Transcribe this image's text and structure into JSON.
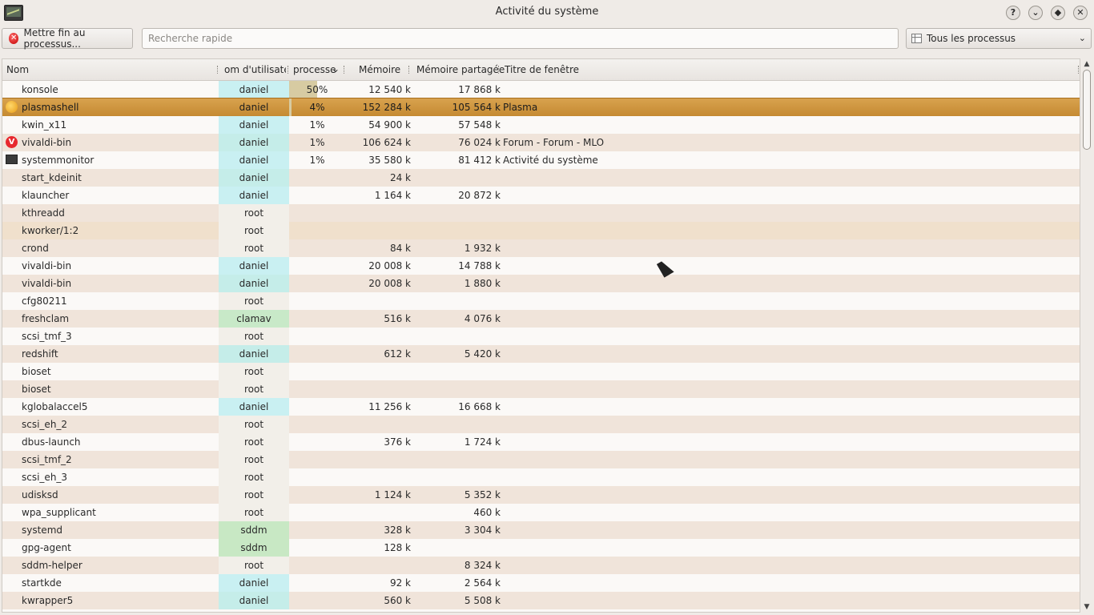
{
  "window": {
    "title": "Activité du système"
  },
  "toolbar": {
    "kill_label": "Mettre fin au processus...",
    "search_placeholder": "Recherche rapide",
    "filter_value": "Tous les processus"
  },
  "columns": {
    "name": "Nom",
    "user": "om d'utilisateı",
    "cpu": "processe",
    "memory": "Mémoire",
    "shared": "Mémoire partagée",
    "window": "Titre de fenêtre"
  },
  "rows": [
    {
      "name": "konsole",
      "user": "daniel",
      "cpu": "50%",
      "cpu_level": 50,
      "mem": "12 540 k",
      "shared": "17 868 k",
      "win": "",
      "icon": ""
    },
    {
      "name": "plasmashell",
      "user": "daniel",
      "cpu": "4%",
      "cpu_level": 4,
      "mem": "152 284 k",
      "shared": "105 564 k",
      "win": "Plasma",
      "icon": "plasma-icon",
      "selected": true
    },
    {
      "name": "kwin_x11",
      "user": "daniel",
      "cpu": "1%",
      "cpu_level": 1,
      "mem": "54 900 k",
      "shared": "57 548 k",
      "win": "",
      "icon": ""
    },
    {
      "name": "vivaldi-bin",
      "user": "daniel",
      "cpu": "1%",
      "cpu_level": 1,
      "mem": "106 624 k",
      "shared": "76 024 k",
      "win": "Forum - Forum - MLO",
      "icon": "vivaldi-icon"
    },
    {
      "name": "systemmonitor",
      "user": "daniel",
      "cpu": "1%",
      "cpu_level": 1,
      "mem": "35 580 k",
      "shared": "81 412 k",
      "win": "Activité du système",
      "icon": "system-monitor-icon"
    },
    {
      "name": "start_kdeinit",
      "user": "daniel",
      "cpu": "",
      "mem": "24 k",
      "shared": "",
      "win": "",
      "icon": ""
    },
    {
      "name": "klauncher",
      "user": "daniel",
      "cpu": "",
      "mem": "1 164 k",
      "shared": "20 872 k",
      "win": "",
      "icon": ""
    },
    {
      "name": "kthreadd",
      "user": "root",
      "cpu": "",
      "mem": "",
      "shared": "",
      "win": "",
      "icon": ""
    },
    {
      "name": "kworker/1:2",
      "user": "root",
      "cpu": "",
      "mem": "",
      "shared": "",
      "win": "",
      "icon": ""
    },
    {
      "name": "crond",
      "user": "root",
      "cpu": "",
      "mem": "84 k",
      "shared": "1 932 k",
      "win": "",
      "icon": ""
    },
    {
      "name": "vivaldi-bin",
      "user": "daniel",
      "cpu": "",
      "mem": "20 008 k",
      "shared": "14 788 k",
      "win": "",
      "icon": ""
    },
    {
      "name": "vivaldi-bin",
      "user": "daniel",
      "cpu": "",
      "mem": "20 008 k",
      "shared": "1 880 k",
      "win": "",
      "icon": ""
    },
    {
      "name": "cfg80211",
      "user": "root",
      "cpu": "",
      "mem": "",
      "shared": "",
      "win": "",
      "icon": ""
    },
    {
      "name": "freshclam",
      "user": "clamav",
      "cpu": "",
      "mem": "516 k",
      "shared": "4 076 k",
      "win": "",
      "icon": ""
    },
    {
      "name": "scsi_tmf_3",
      "user": "root",
      "cpu": "",
      "mem": "",
      "shared": "",
      "win": "",
      "icon": ""
    },
    {
      "name": "redshift",
      "user": "daniel",
      "cpu": "",
      "mem": "612 k",
      "shared": "5 420 k",
      "win": "",
      "icon": ""
    },
    {
      "name": "bioset",
      "user": "root",
      "cpu": "",
      "mem": "",
      "shared": "",
      "win": "",
      "icon": ""
    },
    {
      "name": "bioset",
      "user": "root",
      "cpu": "",
      "mem": "",
      "shared": "",
      "win": "",
      "icon": ""
    },
    {
      "name": "kglobalaccel5",
      "user": "daniel",
      "cpu": "",
      "mem": "11 256 k",
      "shared": "16 668 k",
      "win": "",
      "icon": ""
    },
    {
      "name": "scsi_eh_2",
      "user": "root",
      "cpu": "",
      "mem": "",
      "shared": "",
      "win": "",
      "icon": ""
    },
    {
      "name": "dbus-launch",
      "user": "root",
      "cpu": "",
      "mem": "376 k",
      "shared": "1 724 k",
      "win": "",
      "icon": ""
    },
    {
      "name": "scsi_tmf_2",
      "user": "root",
      "cpu": "",
      "mem": "",
      "shared": "",
      "win": "",
      "icon": ""
    },
    {
      "name": "scsi_eh_3",
      "user": "root",
      "cpu": "",
      "mem": "",
      "shared": "",
      "win": "",
      "icon": ""
    },
    {
      "name": "udisksd",
      "user": "root",
      "cpu": "",
      "mem": "1 124 k",
      "shared": "5 352 k",
      "win": "",
      "icon": ""
    },
    {
      "name": "wpa_supplicant",
      "user": "root",
      "cpu": "",
      "mem": "",
      "shared": "460 k",
      "win": "",
      "icon": ""
    },
    {
      "name": "systemd",
      "user": "sddm",
      "cpu": "",
      "mem": "328 k",
      "shared": "3 304 k",
      "win": "",
      "icon": ""
    },
    {
      "name": "gpg-agent",
      "user": "sddm",
      "cpu": "",
      "mem": "128 k",
      "shared": "",
      "win": "",
      "icon": ""
    },
    {
      "name": "sddm-helper",
      "user": "root",
      "cpu": "",
      "mem": "",
      "shared": "8 324 k",
      "win": "",
      "icon": ""
    },
    {
      "name": "startkde",
      "user": "daniel",
      "cpu": "",
      "mem": "92 k",
      "shared": "2 564 k",
      "win": "",
      "icon": ""
    },
    {
      "name": "kwrapper5",
      "user": "daniel",
      "cpu": "",
      "mem": "560 k",
      "shared": "5 508 k",
      "win": "",
      "icon": ""
    }
  ],
  "colors": {
    "selected_row": "#c58a32",
    "user_daniel": "#c5ede9",
    "user_root": "#f2efe9",
    "user_clamav": "#c8e9c8",
    "user_sddm": "#c8e8c4"
  }
}
